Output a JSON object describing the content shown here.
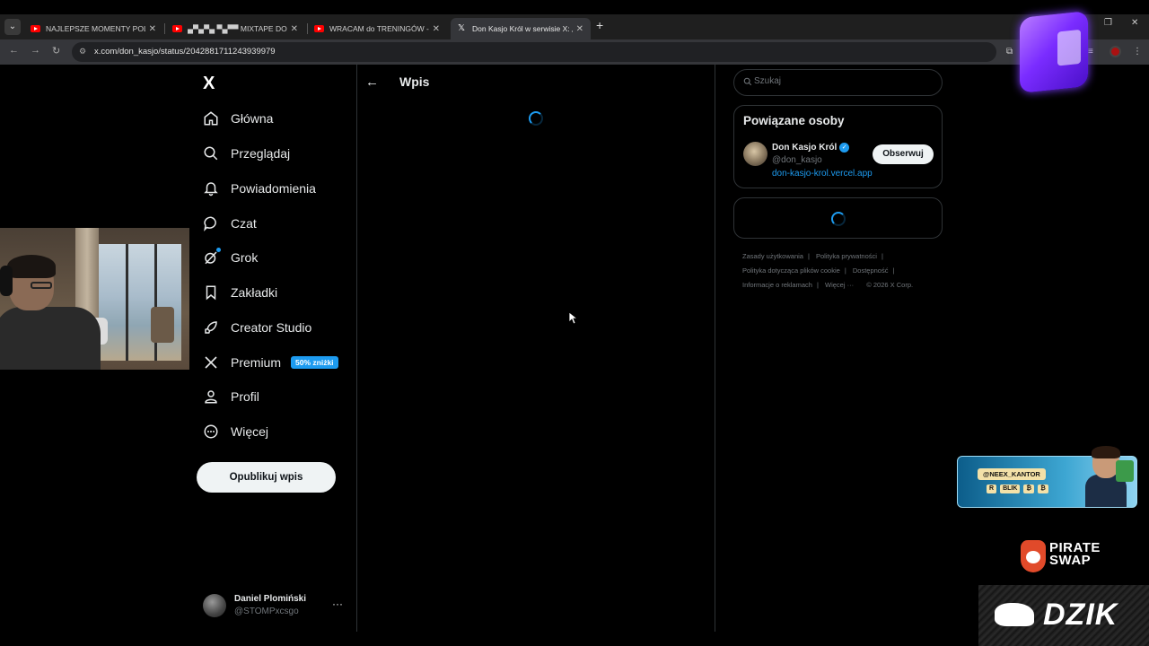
{
  "browser": {
    "tabs": [
      {
        "title": "NAJLEPSZE MOMENTY POLSKIE",
        "favicon": "youtube-icon",
        "active": false
      },
      {
        "title": "▄▀▄▀▄ ▀▄▀▀ MIXTAPE DO 🦣",
        "favicon": "youtube-icon",
        "active": false
      },
      {
        "title": "WRACAM do TRENINGÓW - Yo",
        "favicon": "youtube-icon",
        "active": false
      },
      {
        "title": "Don Kasjo Król w serwisie X: „to",
        "favicon": "x-icon",
        "active": true
      }
    ],
    "url": "x.com/don_kasjo/status/2042881711243939979"
  },
  "x_app": {
    "logo": "X",
    "nav": [
      {
        "label": "Główna",
        "icon": "home-icon"
      },
      {
        "label": "Przeglądaj",
        "icon": "search-icon"
      },
      {
        "label": "Powiadomienia",
        "icon": "bell-icon"
      },
      {
        "label": "Czat",
        "icon": "chat-icon"
      },
      {
        "label": "Grok",
        "icon": "grok-icon"
      },
      {
        "label": "Zakładki",
        "icon": "bookmark-icon"
      },
      {
        "label": "Creator Studio",
        "icon": "rocket-icon"
      },
      {
        "label": "Premium",
        "icon": "x-icon",
        "badge": "50% zniżki"
      },
      {
        "label": "Profil",
        "icon": "person-icon"
      },
      {
        "label": "Więcej",
        "icon": "more-circle-icon"
      }
    ],
    "post_button": "Opublikuj wpis",
    "account": {
      "name": "Daniel Plomiński",
      "handle": "@STOMPxcsgo",
      "more": "···"
    }
  },
  "main": {
    "title": "Wpis"
  },
  "sidebar": {
    "search_placeholder": "Szukaj",
    "related": {
      "title": "Powiązane osoby",
      "person": {
        "name": "Don Kasjo Król",
        "handle": "@don_kasjo",
        "link": "don-kasjo-krol.vercel.app",
        "follow": "Obserwuj"
      }
    },
    "footer": {
      "terms": "Zasady użytkowania",
      "privacy": "Polityka prywatności",
      "cookies": "Polityka dotycząca plików cookie",
      "accessibility": "Dostępność",
      "ads": "Informacje o reklamach",
      "more": "Więcej ···",
      "copyright": "© 2026 X Corp."
    }
  },
  "overlays": {
    "neex": {
      "tag": "@NEEX_KANTOR",
      "row": [
        "R",
        "BLIK",
        "₿",
        "₿"
      ]
    },
    "pirate": {
      "line1": "PIRATE",
      "line2": "SWAP"
    },
    "dzik": "DZIK"
  },
  "colors": {
    "accent": "#1d9bf0",
    "background": "#000000",
    "border": "#2f3336",
    "muted": "#71767b"
  }
}
